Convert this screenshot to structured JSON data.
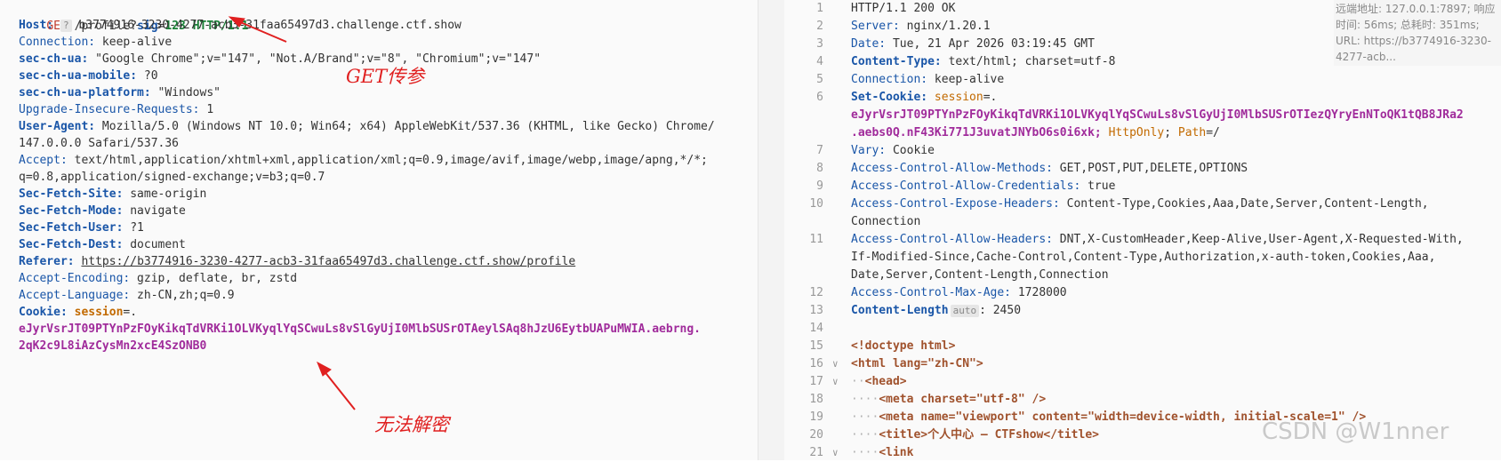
{
  "request": {
    "line1": {
      "method": "GET",
      "path": " /profile?",
      "param_key": "sig",
      "eq": "=",
      "param_val": "123",
      "proto": " HTTP/1.1"
    },
    "host": {
      "key": "Host:",
      "icon": "?",
      "value": " b3774916-3230-4277-acb3-31faa65497d3.challenge.ctf.show"
    },
    "connection": {
      "key": "Connection:",
      "value": " keep-alive"
    },
    "sec_ch_ua": {
      "key": "sec-ch-ua:",
      "value": " \"Google Chrome\";v=\"147\", \"Not.A/Brand\";v=\"8\", \"Chromium\";v=\"147\""
    },
    "sec_ch_ua_mobile": {
      "key": "sec-ch-ua-mobile:",
      "value": " ?0"
    },
    "sec_ch_ua_platform": {
      "key": "sec-ch-ua-platform:",
      "value": " \"Windows\""
    },
    "upgrade": {
      "key": "Upgrade-Insecure-Requests:",
      "value": " 1"
    },
    "user_agent": {
      "key": "User-Agent:",
      "value": " Mozilla/5.0 (Windows NT 10.0; Win64; x64) AppleWebKit/537.36 (KHTML, like Gecko) Chrome/",
      "cont": "147.0.0.0 Safari/537.36"
    },
    "accept": {
      "key": "Accept:",
      "value": " text/html,application/xhtml+xml,application/xml;q=0.9,image/avif,image/webp,image/apng,*/*;",
      "cont": "q=0.8,application/signed-exchange;v=b3;q=0.7"
    },
    "sec_fetch_site": {
      "key": "Sec-Fetch-Site:",
      "value": " same-origin"
    },
    "sec_fetch_mode": {
      "key": "Sec-Fetch-Mode:",
      "value": " navigate"
    },
    "sec_fetch_user": {
      "key": "Sec-Fetch-User:",
      "value": " ?1"
    },
    "sec_fetch_dest": {
      "key": "Sec-Fetch-Dest:",
      "value": " document"
    },
    "referer": {
      "key": "Referer:",
      "value": "https://b3774916-3230-4277-acb3-31faa65497d3.challenge.ctf.show/profile"
    },
    "accept_encoding": {
      "key": "Accept-Encoding:",
      "value": " gzip, deflate, br, zstd"
    },
    "accept_language": {
      "key": "Accept-Language:",
      "value": " zh-CN,zh;q=0.9"
    },
    "cookie": {
      "key": "Cookie:",
      "name": " session",
      "eq": "=.",
      "line2": "eJyrVsrJT09PTYnPzFOyKikqTdVRKi1OLVKyqlYqSCwuLs8vSlGyUjI0MlbSUSrOTAeylSAq8hJzU6EytbUAPuMWIA.aebrng.",
      "line3": "2qK2c9L8iAzCysMn2xcE4SzONB0"
    }
  },
  "annotations": {
    "get_param": "GET传参",
    "cannot_decrypt": "无法解密"
  },
  "response": {
    "lines": [
      {
        "num": "1",
        "text": "HTTP/1.1 200 OK"
      },
      {
        "num": "2",
        "key": "Server:",
        "value": " nginx/1.20.1"
      },
      {
        "num": "3",
        "key": "Date:",
        "value": " Tue, 21 Apr 2026 03:19:45 GMT"
      },
      {
        "num": "4",
        "key": "Content-Type:",
        "value": " text/html; charset=utf-8"
      },
      {
        "num": "5",
        "key": "Connection:",
        "value": " keep-alive"
      },
      {
        "num": "6",
        "key": "Set-Cookie:",
        "cname": " session",
        "ceq": "=.",
        "line2": "eJyrVsrJT09PTYnPzFOyKikqTdVRKi1OLVKyqlYqSCwuLs8vSlGyUjI0MlbSUSrOTIezQYryEnNToQK1tQB8JRa2",
        "line3a": ".aebs0Q.nF43Ki771J3uvatJNYbO6s0i6xk;",
        "http_only": " HttpOnly",
        "semi": ";",
        "path_k": " Path",
        "path_v": "=/"
      },
      {
        "num": "7",
        "key": "Vary:",
        "value": " Cookie"
      },
      {
        "num": "8",
        "key": "Access-Control-Allow-Methods:",
        "value": " GET,POST,PUT,DELETE,OPTIONS"
      },
      {
        "num": "9",
        "key": "Access-Control-Allow-Credentials:",
        "value": " true"
      },
      {
        "num": "10",
        "key": "Access-Control-Expose-Headers:",
        "value": " Content-Type,Cookies,Aaa,Date,Server,Content-Length,",
        "cont": "Connection"
      },
      {
        "num": "11",
        "key": "Access-Control-Allow-Headers:",
        "value": " DNT,X-CustomHeader,Keep-Alive,User-Agent,X-Requested-With,",
        "cont": "If-Modified-Since,Cache-Control,Content-Type,Authorization,x-auth-token,Cookies,Aaa,",
        "cont2": "Date,Server,Content-Length,Connection"
      },
      {
        "num": "12",
        "key": "Access-Control-Max-Age:",
        "value": " 1728000"
      },
      {
        "num": "13",
        "key": "Content-Length",
        "badge": "auto",
        "value": ": 2450"
      },
      {
        "num": "14"
      },
      {
        "num": "15",
        "text": "<!doctype html>"
      },
      {
        "num": "16",
        "text": "<html lang=\"zh-CN\">"
      },
      {
        "num": "17",
        "text": "<head>"
      },
      {
        "num": "18",
        "text": "<meta charset=\"utf-8\" />"
      },
      {
        "num": "19",
        "text": "<meta name=\"viewport\" content=\"width=device-width, initial-scale=1\" />"
      },
      {
        "num": "20",
        "text": "<title>个人中心 — CTFshow</title>"
      },
      {
        "num": "21",
        "text": "<link"
      }
    ]
  },
  "remote_info": "远端地址: 127.0.0.1:7897; 响应时间: 56ms; 总耗时: 351ms; URL: https://b3774916-3230-4277-acb...",
  "watermark": "CSDN @W1nner"
}
